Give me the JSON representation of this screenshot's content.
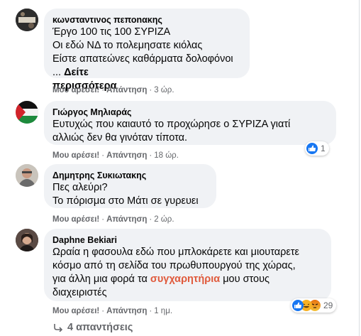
{
  "comments": [
    {
      "author": "κωνσταντινος πεποnακης",
      "lines": [
        "Έργο 100 τις 100 ΣΥΡΙΖΑ",
        "Οι εδώ ΝΔ το πολεμησατε κιόλας",
        "Είστε απατεώνες καθάρματα δολοφόνοι ..."
      ],
      "see_more_1": "Δείτε",
      "see_more_2": "περισσότερα",
      "like": "Μου αρέσει!",
      "reply": "Απάντηση",
      "time": "3 ώρ."
    },
    {
      "author": "Γιώργος Μηλιαράς",
      "lines": [
        "Ευτυχώς που καιαυτό το προχώρησε ο ΣΥΡΙΖΑ γιατί",
        "αλλιώς δεν θα γινόταν τίποτα."
      ],
      "like": "Μου αρέσει!",
      "reply": "Απάντηση",
      "time": "18 ώρ.",
      "reaction_count": "1"
    },
    {
      "author": "Δημητρης Συκιωτακης",
      "lines": [
        "Πες αλεύρι?",
        "Το πόρισμα στο Μάτι σε γυρευει"
      ],
      "like": "Μου αρέσει!",
      "reply": "Απάντηση",
      "time": "2 ώρ."
    },
    {
      "author": "Daphne Bekiari",
      "lines": [
        "Ωραία η φασουλα εδώ που μπλοκάρετε και μιουταρετε",
        "κόσμο από τη σελίδα του πρωθυπουργού της χώρας,",
        "για άλλη μια φορά τα"
      ],
      "highlight": "συγχαρητήρια",
      "line3_end": "μου στους",
      "line4": "διαχειριστές",
      "like": "Μου αρέσει!",
      "reply": "Απάντηση",
      "time": "1 ημ.",
      "reaction_count": "29"
    }
  ],
  "replies_label": "4 απαντήσεις",
  "colors": {
    "bubble": "#f0f2f5",
    "meta": "#65676b",
    "like_blue": "#1877f2",
    "highlight": "#e05a3c"
  }
}
